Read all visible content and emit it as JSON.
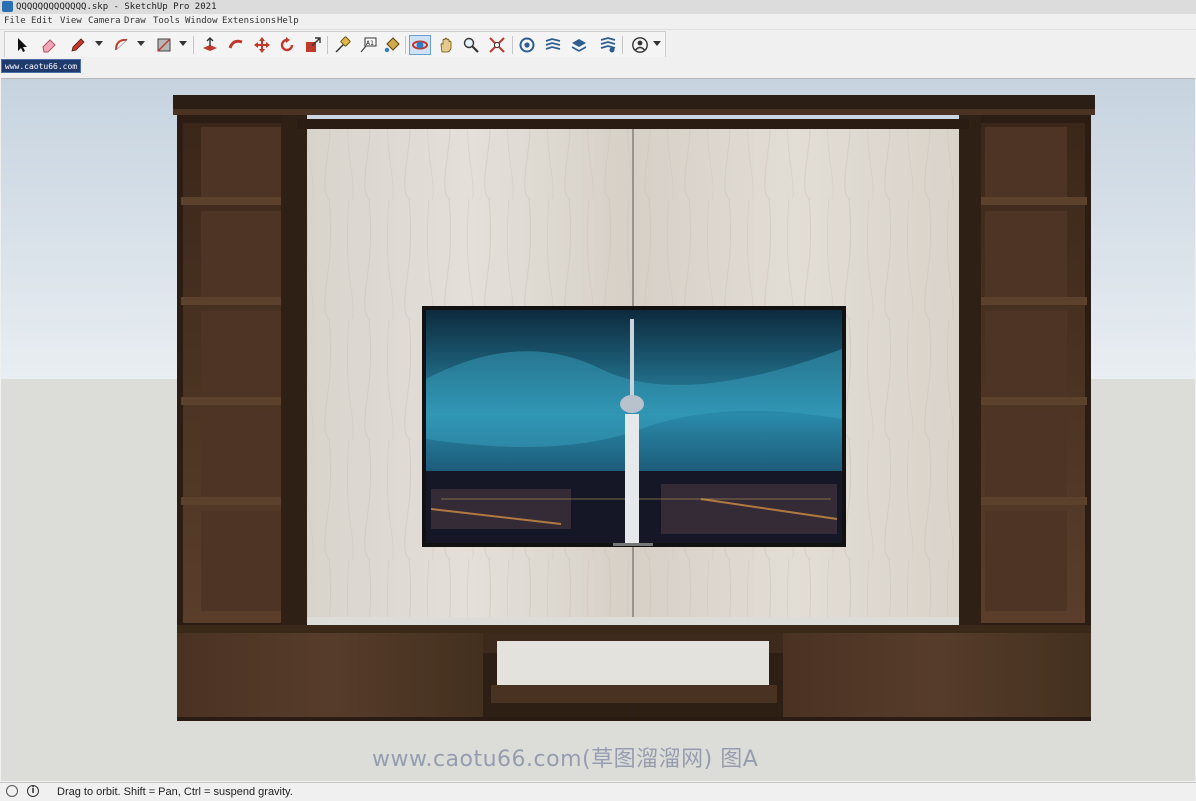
{
  "window": {
    "title": "QQQQQQQQQQQQQ.skp - SketchUp Pro 2021"
  },
  "menu": {
    "items": [
      "File",
      "Edit",
      "View",
      "Camera",
      "Draw",
      "Tools",
      "Window",
      "Extensions",
      "Help"
    ]
  },
  "toolbar": {
    "tools": [
      {
        "name": "select-icon"
      },
      {
        "name": "eraser-icon"
      },
      {
        "name": "pencil-line-icon",
        "has_dropdown": true
      },
      {
        "name": "arc-icon",
        "has_dropdown": true
      },
      {
        "name": "rectangle-icon",
        "has_dropdown": true
      },
      {
        "name": "push-pull-icon"
      },
      {
        "name": "follow-me-icon"
      },
      {
        "name": "move-icon"
      },
      {
        "name": "rotate-icon"
      },
      {
        "name": "scale-icon"
      },
      {
        "name": "tape-measure-icon"
      },
      {
        "name": "text-icon",
        "label": "A1"
      },
      {
        "name": "paint-bucket-icon"
      },
      {
        "name": "orbit-icon",
        "active": true
      },
      {
        "name": "pan-icon"
      },
      {
        "name": "zoom-icon"
      },
      {
        "name": "zoom-extents-icon"
      },
      {
        "name": "3d-warehouse-icon"
      },
      {
        "name": "extension-warehouse-icon"
      },
      {
        "name": "layout-icon"
      },
      {
        "name": "extension-manager-icon"
      },
      {
        "name": "account-icon",
        "has_dropdown": true
      }
    ]
  },
  "scenes": {
    "tabs": [
      {
        "label": "www.caotu66.com"
      }
    ]
  },
  "status": {
    "text": "Drag to orbit. Shift = Pan, Ctrl = suspend gravity."
  },
  "watermark": {
    "text": "www.caotu66.com(草图溜溜网) 图A"
  },
  "colors": {
    "wood_dark": "#3a2a1f",
    "wood_mid": "#4e3727",
    "marble": "#ddd8d0",
    "screen_sky": "#1e5e7c",
    "active_tool": "#cfe1f5",
    "scene_tab": "#1f3a6d"
  }
}
